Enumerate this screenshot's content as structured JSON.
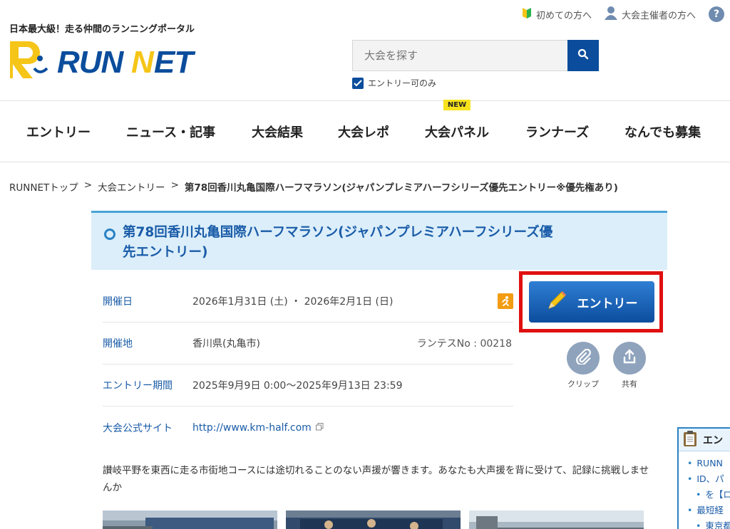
{
  "header": {
    "tagline": "日本最大級！走る仲間のランニングポータル",
    "logo_text": "RUNNET",
    "top_links": [
      {
        "label": "初めての方へ",
        "icon": "beginner-icon"
      },
      {
        "label": "大会主催者の方へ",
        "icon": "person-icon"
      }
    ],
    "help_label": "?",
    "search": {
      "placeholder": "大会を探す"
    },
    "entry_only_label": "エントリー可のみ"
  },
  "nav": {
    "items": [
      {
        "label": "エントリー"
      },
      {
        "label": "ニュース・記事"
      },
      {
        "label": "大会結果"
      },
      {
        "label": "大会レポ"
      },
      {
        "label": "大会パネル",
        "badge": "NEW"
      },
      {
        "label": "ランナーズ"
      },
      {
        "label": "なんでも募集"
      }
    ]
  },
  "breadcrumb": {
    "items": [
      "RUNNETトップ",
      "大会エントリー"
    ],
    "separator": ">",
    "current": "第78回香川丸亀国際ハーフマラソン(ジャパンプレミアハーフシリーズ優先エントリー※優先権あり)"
  },
  "event": {
    "title_line1": "第78回香川丸亀国際ハーフマラソン(ジャパンプレミアハーフシリーズ優",
    "title_line2": "先エントリー)",
    "rows": [
      {
        "label": "開催日",
        "value": "2026年1月31日 (土) ・ 2026年2月1日 (日)"
      },
      {
        "label": "開催地",
        "value": "香川県(丸亀市)",
        "extra": "ランテスNo : 00218"
      },
      {
        "label": "エントリー期間",
        "value": "2025年9月9日 0:00〜2025年9月13日 23:59"
      },
      {
        "label": "大会公式サイト",
        "value": "http://www.km-half.com"
      }
    ],
    "entry_button": "エントリー",
    "clip_label": "クリップ",
    "share_label": "共有",
    "description": "讃岐平野を東西に走る市街地コースには途切れることのない声援が響きます。あなたも大声援を背に受けて、記録に挑戦しませんか"
  },
  "side_panel": {
    "title": "エン",
    "items": [
      "RUNN",
      "ID、パ",
      "を【ロ",
      "最短経",
      "東京都"
    ]
  },
  "colors": {
    "brand_blue": "#0b4d9c",
    "link_blue": "#1a5ca8",
    "highlight_red": "#e01010",
    "title_bg": "#dbeefa"
  }
}
